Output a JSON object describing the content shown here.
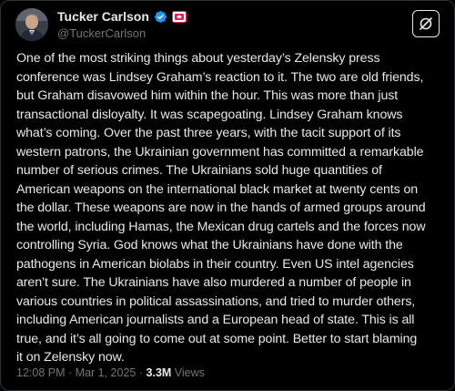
{
  "author": {
    "display_name": "Tucker Carlson",
    "handle": "@TuckerCarlson"
  },
  "icons": {
    "verified": "verified-badge-icon",
    "affiliation": "media-affiliation-icon",
    "grok": "grok-icon"
  },
  "colors": {
    "verified": "#1d9bf0",
    "affiliation": "#e0245e",
    "background": "#000000",
    "text": "#e7e9ea",
    "muted": "#71767b"
  },
  "tweet": {
    "lines": [
      "One of the most striking things about yesterday’s Zelensky press",
      "conference was Lindsey Graham’s reaction to it. The two are old friends,",
      "but Graham disavowed him within the hour. This was more than just",
      "transactional disloyalty. It was scapegoating. Lindsey Graham knows",
      "what’s coming. Over the past three years, with the tacit support of its",
      "western patrons, the Ukrainian government has committed a remarkable",
      "number of serious crimes. The Ukrainians sold huge quantities of",
      "American weapons on the international black market at twenty cents on",
      "the dollar. These weapons are now in the hands of armed groups around",
      "the world, including Hamas, the Mexican drug cartels and the forces now",
      "controlling Syria. God knows what the Ukrainians have done with the",
      "pathogens in American biolabs in their country. Even US intel agencies",
      "aren’t sure. The Ukrainians have also murdered a number of people in",
      "various countries in political assassinations, and tried to murder others,",
      "including American journalists and a European head of state. This is all",
      "true, and it’s all going to come out at some point. Better to start blaming",
      "it on Zelensky now."
    ]
  },
  "meta": {
    "time": "12:08 PM",
    "separator": "·",
    "date": "Mar 1, 2025",
    "views_count": "3.3M",
    "views_label": "Views"
  }
}
